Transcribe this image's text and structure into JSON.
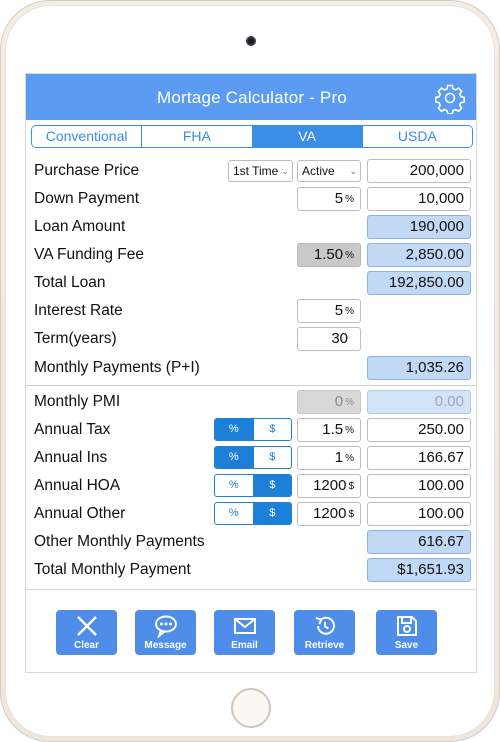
{
  "header": {
    "title": "Mortage Calculator - Pro"
  },
  "tabs": [
    {
      "label": "Conventional",
      "active": false
    },
    {
      "label": "FHA",
      "active": false
    },
    {
      "label": "VA",
      "active": true
    },
    {
      "label": "USDA",
      "active": false
    }
  ],
  "rows": {
    "purchase_price": {
      "label": "Purchase Price",
      "buyer_select": "1st Time",
      "status_select": "Active",
      "value": "200,000"
    },
    "down_payment": {
      "label": "Down Payment",
      "percent": "5",
      "percent_unit": "%",
      "value": "10,000"
    },
    "loan_amount": {
      "label": "Loan Amount",
      "value": "190,000"
    },
    "va_funding_fee": {
      "label": "VA Funding Fee",
      "percent": "1.50",
      "percent_unit": "%",
      "value": "2,850.00"
    },
    "total_loan": {
      "label": "Total Loan",
      "value": "192,850.00"
    },
    "interest_rate": {
      "label": "Interest Rate",
      "percent": "5",
      "percent_unit": "%"
    },
    "term": {
      "label": "Term(years)",
      "value": "30"
    },
    "monthly_payments": {
      "label": "Monthly Payments (P+I)",
      "value": "1,035.26"
    },
    "monthly_pmi": {
      "label": "Monthly PMI",
      "percent": "0",
      "percent_unit": "%",
      "value": "0.00"
    },
    "annual_tax": {
      "label": "Annual Tax",
      "toggle_pct": "%",
      "toggle_usd": "$",
      "mode": "percent",
      "input": "1.5",
      "input_unit": "%",
      "value": "250.00"
    },
    "annual_ins": {
      "label": "Annual Ins",
      "toggle_pct": "%",
      "toggle_usd": "$",
      "mode": "percent",
      "input": "1",
      "input_unit": "%",
      "value": "166.67"
    },
    "annual_hoa": {
      "label": "Annual HOA",
      "toggle_pct": "%",
      "toggle_usd": "$",
      "mode": "dollar",
      "input": "1200",
      "input_unit": "$",
      "value": "100.00"
    },
    "annual_other": {
      "label": "Annual Other",
      "toggle_pct": "%",
      "toggle_usd": "$",
      "mode": "dollar",
      "input": "1200",
      "input_unit": "$",
      "value": "100.00"
    },
    "other_monthly": {
      "label": "Other Monthly Payments",
      "value": "616.67"
    },
    "total_monthly": {
      "label": "Total Monthly Payment",
      "value": "$1,651.93"
    }
  },
  "toolbar": {
    "clear": "Clear",
    "message": "Message",
    "email": "Email",
    "retrieve": "Retrieve",
    "save": "Save"
  },
  "colors": {
    "nav": "#5c9bf2",
    "accent": "#3a8ee6",
    "result_fill": "#c2d9f6",
    "button": "#4f8ee8"
  }
}
